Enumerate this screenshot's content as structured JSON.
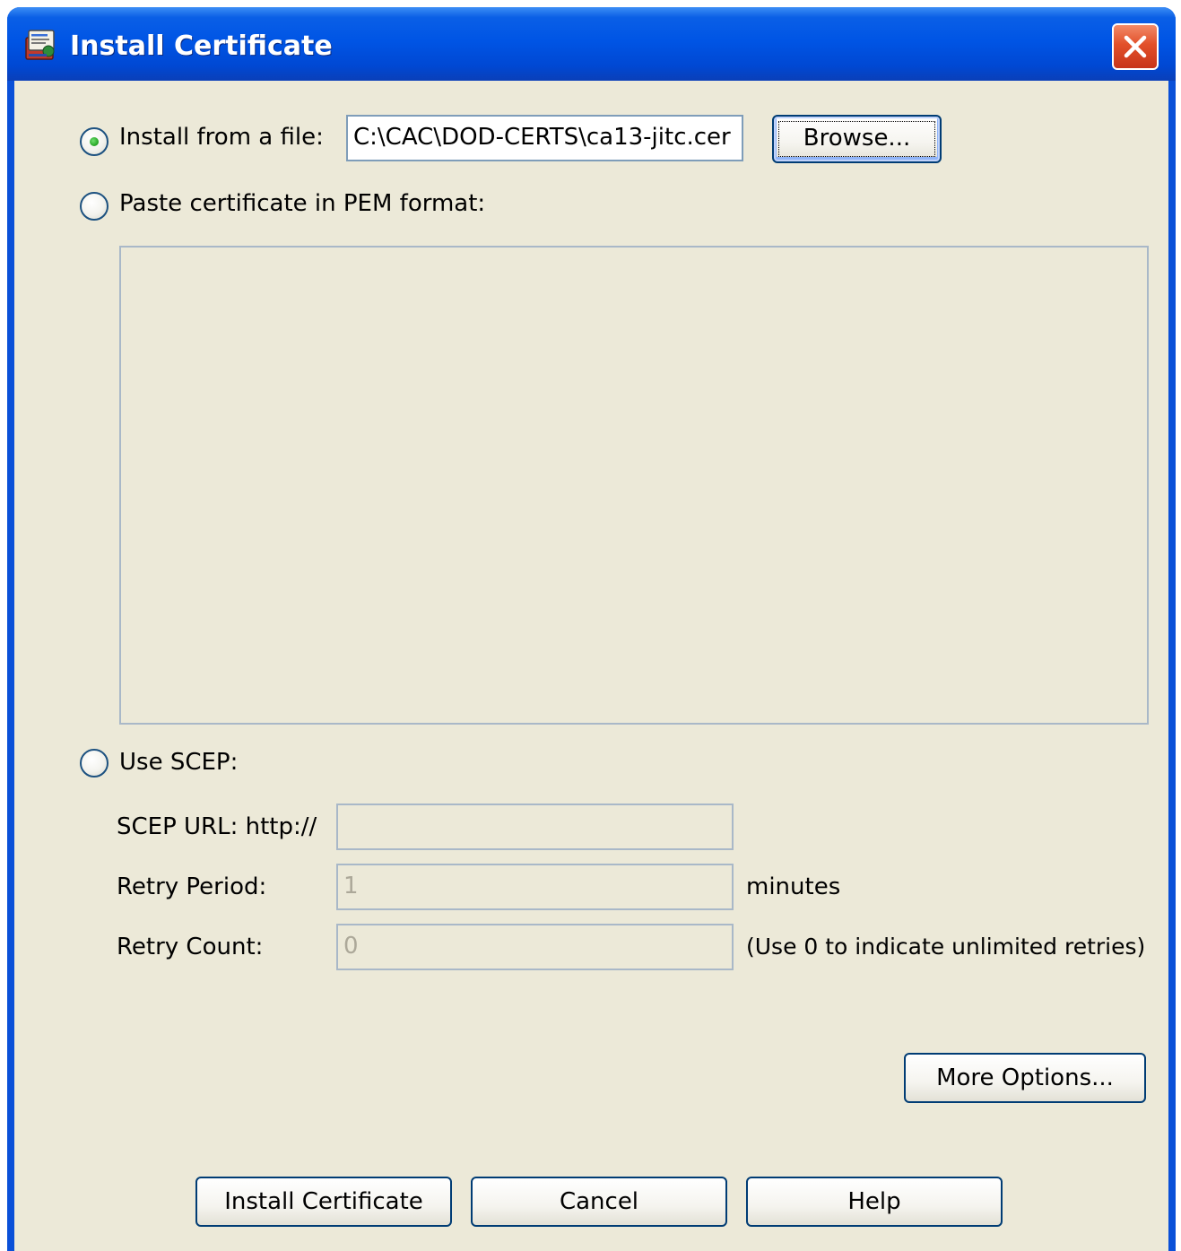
{
  "window": {
    "title": "Install Certificate"
  },
  "options": {
    "from_file": {
      "label": "Install from a file:",
      "selected": true,
      "path_value": "C:\\CAC\\DOD-CERTS\\ca13-jitc.cer",
      "browse_label": "Browse..."
    },
    "pem": {
      "label": "Paste certificate in PEM format:",
      "selected": false,
      "text_value": ""
    },
    "scep": {
      "label": "Use SCEP:",
      "selected": false,
      "url_label": "SCEP URL: http://",
      "url_value": "",
      "retry_period_label": "Retry Period:",
      "retry_period_value": "1",
      "retry_period_unit": "minutes",
      "retry_count_label": "Retry Count:",
      "retry_count_value": "0",
      "retry_count_hint": "(Use 0 to indicate unlimited retries)"
    }
  },
  "buttons": {
    "more_options": "More Options...",
    "install": "Install Certificate",
    "cancel": "Cancel",
    "help": "Help"
  },
  "colors": {
    "titlebar": "#0055e5",
    "dialog_bg": "#ece9d8",
    "close": "#e2502a",
    "radio_selected": "#21a121"
  },
  "icons": {
    "app": "certificate-app-icon",
    "close": "close-icon"
  }
}
